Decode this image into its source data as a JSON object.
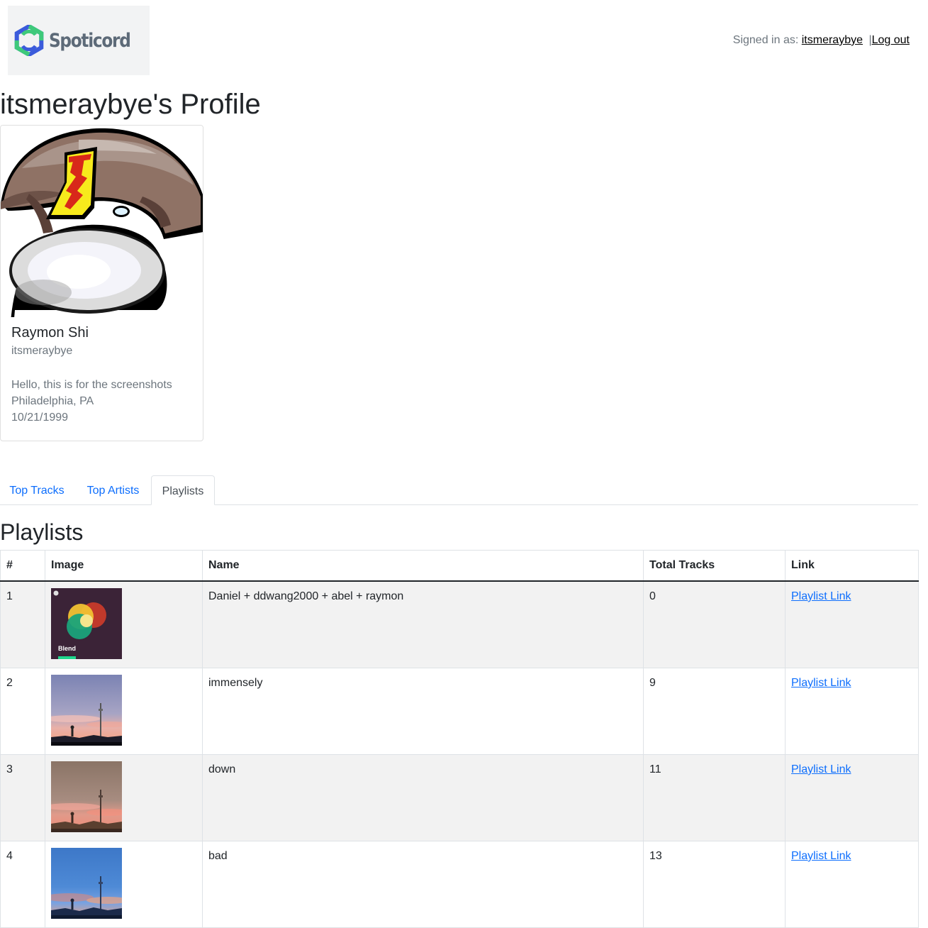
{
  "header": {
    "logo_text": "Spoticord",
    "signed_in_label": "Signed in as:",
    "username_link": "itsmeraybye",
    "separator": "|",
    "logout_link": "Log out"
  },
  "profile": {
    "title": "itsmeraybye's Profile",
    "name": "Raymon Shi",
    "username": "itsmeraybye",
    "bio": "Hello, this is for the screenshots",
    "location": "Philadelphia, PA",
    "birthday": "10/21/1999"
  },
  "tabs": [
    {
      "label": "Top Tracks",
      "active": false
    },
    {
      "label": "Top Artists",
      "active": false
    },
    {
      "label": "Playlists",
      "active": true
    }
  ],
  "playlists": {
    "heading": "Playlists",
    "columns": [
      "#",
      "Image",
      "Name",
      "Total Tracks",
      "Link"
    ],
    "rows": [
      {
        "num": "1",
        "cover": "blend-cover",
        "cover_label": "Blend",
        "name": "Daniel + ddwang2000 + abel + raymon",
        "tracks": "0",
        "link": "Playlist Link"
      },
      {
        "num": "2",
        "cover": "violet-sky-cover",
        "name": "immensely",
        "tracks": "9",
        "link": "Playlist Link"
      },
      {
        "num": "3",
        "cover": "dusk-sky-cover",
        "name": "down",
        "tracks": "11",
        "link": "Playlist Link"
      },
      {
        "num": "4",
        "cover": "blue-sky-cover",
        "name": "bad",
        "tracks": "13",
        "link": "Playlist Link"
      }
    ]
  },
  "colors": {
    "link": "#0d6efd",
    "muted": "#6c757d",
    "stripe": "#f2f2f2",
    "logo_green": "#3ec97a",
    "logo_blue": "#3b5bdb"
  }
}
